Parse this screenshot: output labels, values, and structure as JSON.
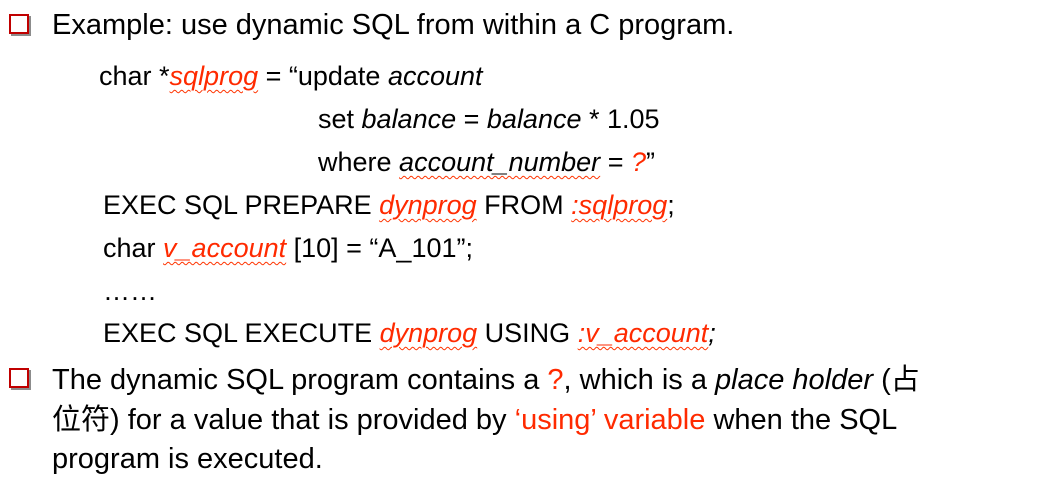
{
  "bullet1": {
    "text": "Example: use dynamic SQL from within a C program."
  },
  "code": {
    "line1_prefix": "char *",
    "line1_var": "sqlprog",
    "line1_mid": " = “update ",
    "line1_table": "account",
    "line2_set": "set ",
    "line2_col1": "balance",
    "line2_eq": " = ",
    "line2_col2": "balance",
    "line2_rest": " * 1.05",
    "line3_where": "where ",
    "line3_col": "account_number",
    "line3_eq": " = ",
    "line3_q": "?",
    "line3_close": "”",
    "line4_pre": "EXEC SQL PREPARE ",
    "line4_stmt": "dynprog",
    "line4_from": "  FROM ",
    "line4_var": ":sqlprog",
    "line4_semi": ";",
    "line5_pre": "char ",
    "line5_var": "v_account",
    "line5_rest": " [10] = “A_101”;",
    "line6": "……",
    "line7_pre": "EXEC SQL EXECUTE ",
    "line7_stmt": "dynprog",
    "line7_using": " USING ",
    "line7_var": ":v_account",
    "line7_semi": ";"
  },
  "bullet2": {
    "part1": "The dynamic SQL program contains a ",
    "q": "?",
    "part2": ", which is a ",
    "term": "place holder",
    "part3": " (",
    "cjk1": "占",
    "cjk2": "位符",
    "part4": ") for a value that is provided by ",
    "using": "‘using’ variable",
    "part5": " when the SQL",
    "part6": "program is executed."
  },
  "colors": {
    "bullet_box": "#c00000",
    "highlight": "#ff2a00"
  }
}
